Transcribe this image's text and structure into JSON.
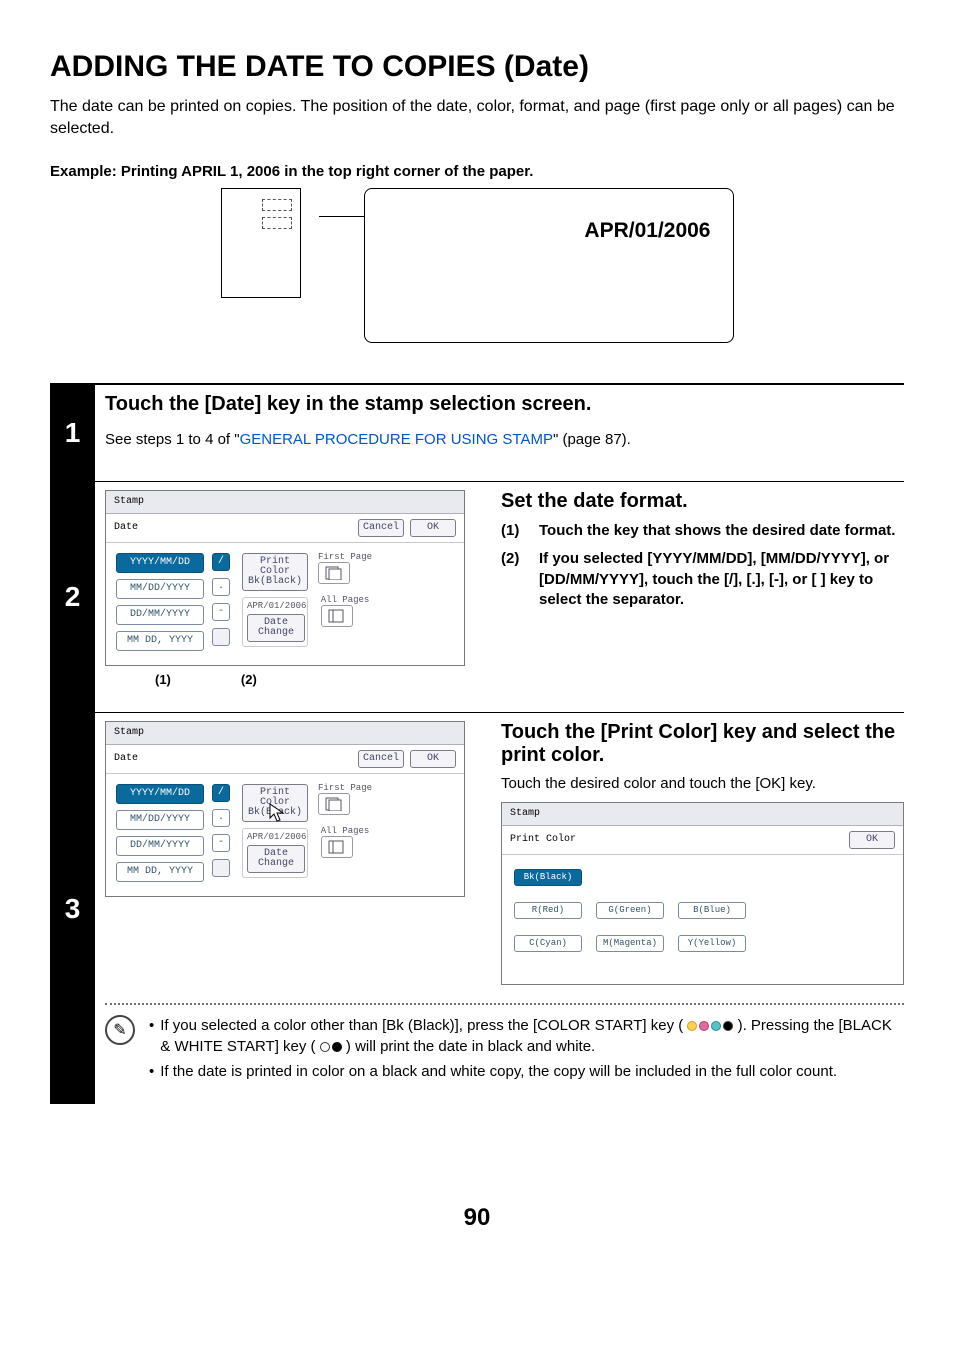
{
  "title": "ADDING THE DATE TO COPIES (Date)",
  "intro": "The date can be printed on copies. The position of the date, color, format, and page (first page only or all pages) can be selected.",
  "example_label": "Example: Printing APRIL 1, 2006 in the top right corner of the paper.",
  "example_date": "APR/01/2006",
  "step1": {
    "num": "1",
    "title": "Touch the [Date] key in the stamp selection screen.",
    "sub_prefix": "See steps 1 to 4 of \"",
    "link": "GENERAL PROCEDURE FOR USING STAMP",
    "sub_suffix": "\" (page 87)."
  },
  "panel_common": {
    "stamp": "Stamp",
    "date": "Date",
    "cancel": "Cancel",
    "ok": "OK",
    "formats": [
      "YYYY/MM/DD",
      "MM/DD/YYYY",
      "DD/MM/YYYY",
      "MM DD, YYYY"
    ],
    "seps": [
      "/",
      ".",
      "-",
      " "
    ],
    "print_color": "Print Color",
    "bk_black": "Bk(Black)",
    "date_value": "APR/01/2006",
    "date_change": "Date Change",
    "first_page": "First Page",
    "all_pages": "All Pages"
  },
  "step2": {
    "num": "2",
    "title": "Set the date format.",
    "s1n": "(1)",
    "s1t": "Touch the key that shows the desired date format.",
    "s2n": "(2)",
    "s2t": "If you selected [YYYY/MM/DD], [MM/DD/YYYY], or [DD/MM/YYYY], touch the [/], [.], [-], or [ ] key to select the separator.",
    "c1": "(1)",
    "c2": "(2)"
  },
  "step3": {
    "num": "3",
    "title": "Touch the [Print Color] key and select the print color.",
    "sub": "Touch the desired color and touch the [OK] key.",
    "panel2": {
      "title": "Stamp",
      "sub": "Print Color",
      "ok": "OK",
      "colors": [
        "Bk(Black)",
        "R(Red)",
        "G(Green)",
        "B(Blue)",
        "C(Cyan)",
        "M(Magenta)",
        "Y(Yellow)"
      ]
    }
  },
  "notes": {
    "n1a": "If you selected a color other than [Bk (Black)], press the [COLOR START] key (",
    "n1b": "). Pressing the [BLACK & WHITE START] key (",
    "n1c": ") will print the date in black and white.",
    "n2": "If the date is printed in color on a black and white copy, the copy will be included in the full color count."
  },
  "page_number": "90"
}
